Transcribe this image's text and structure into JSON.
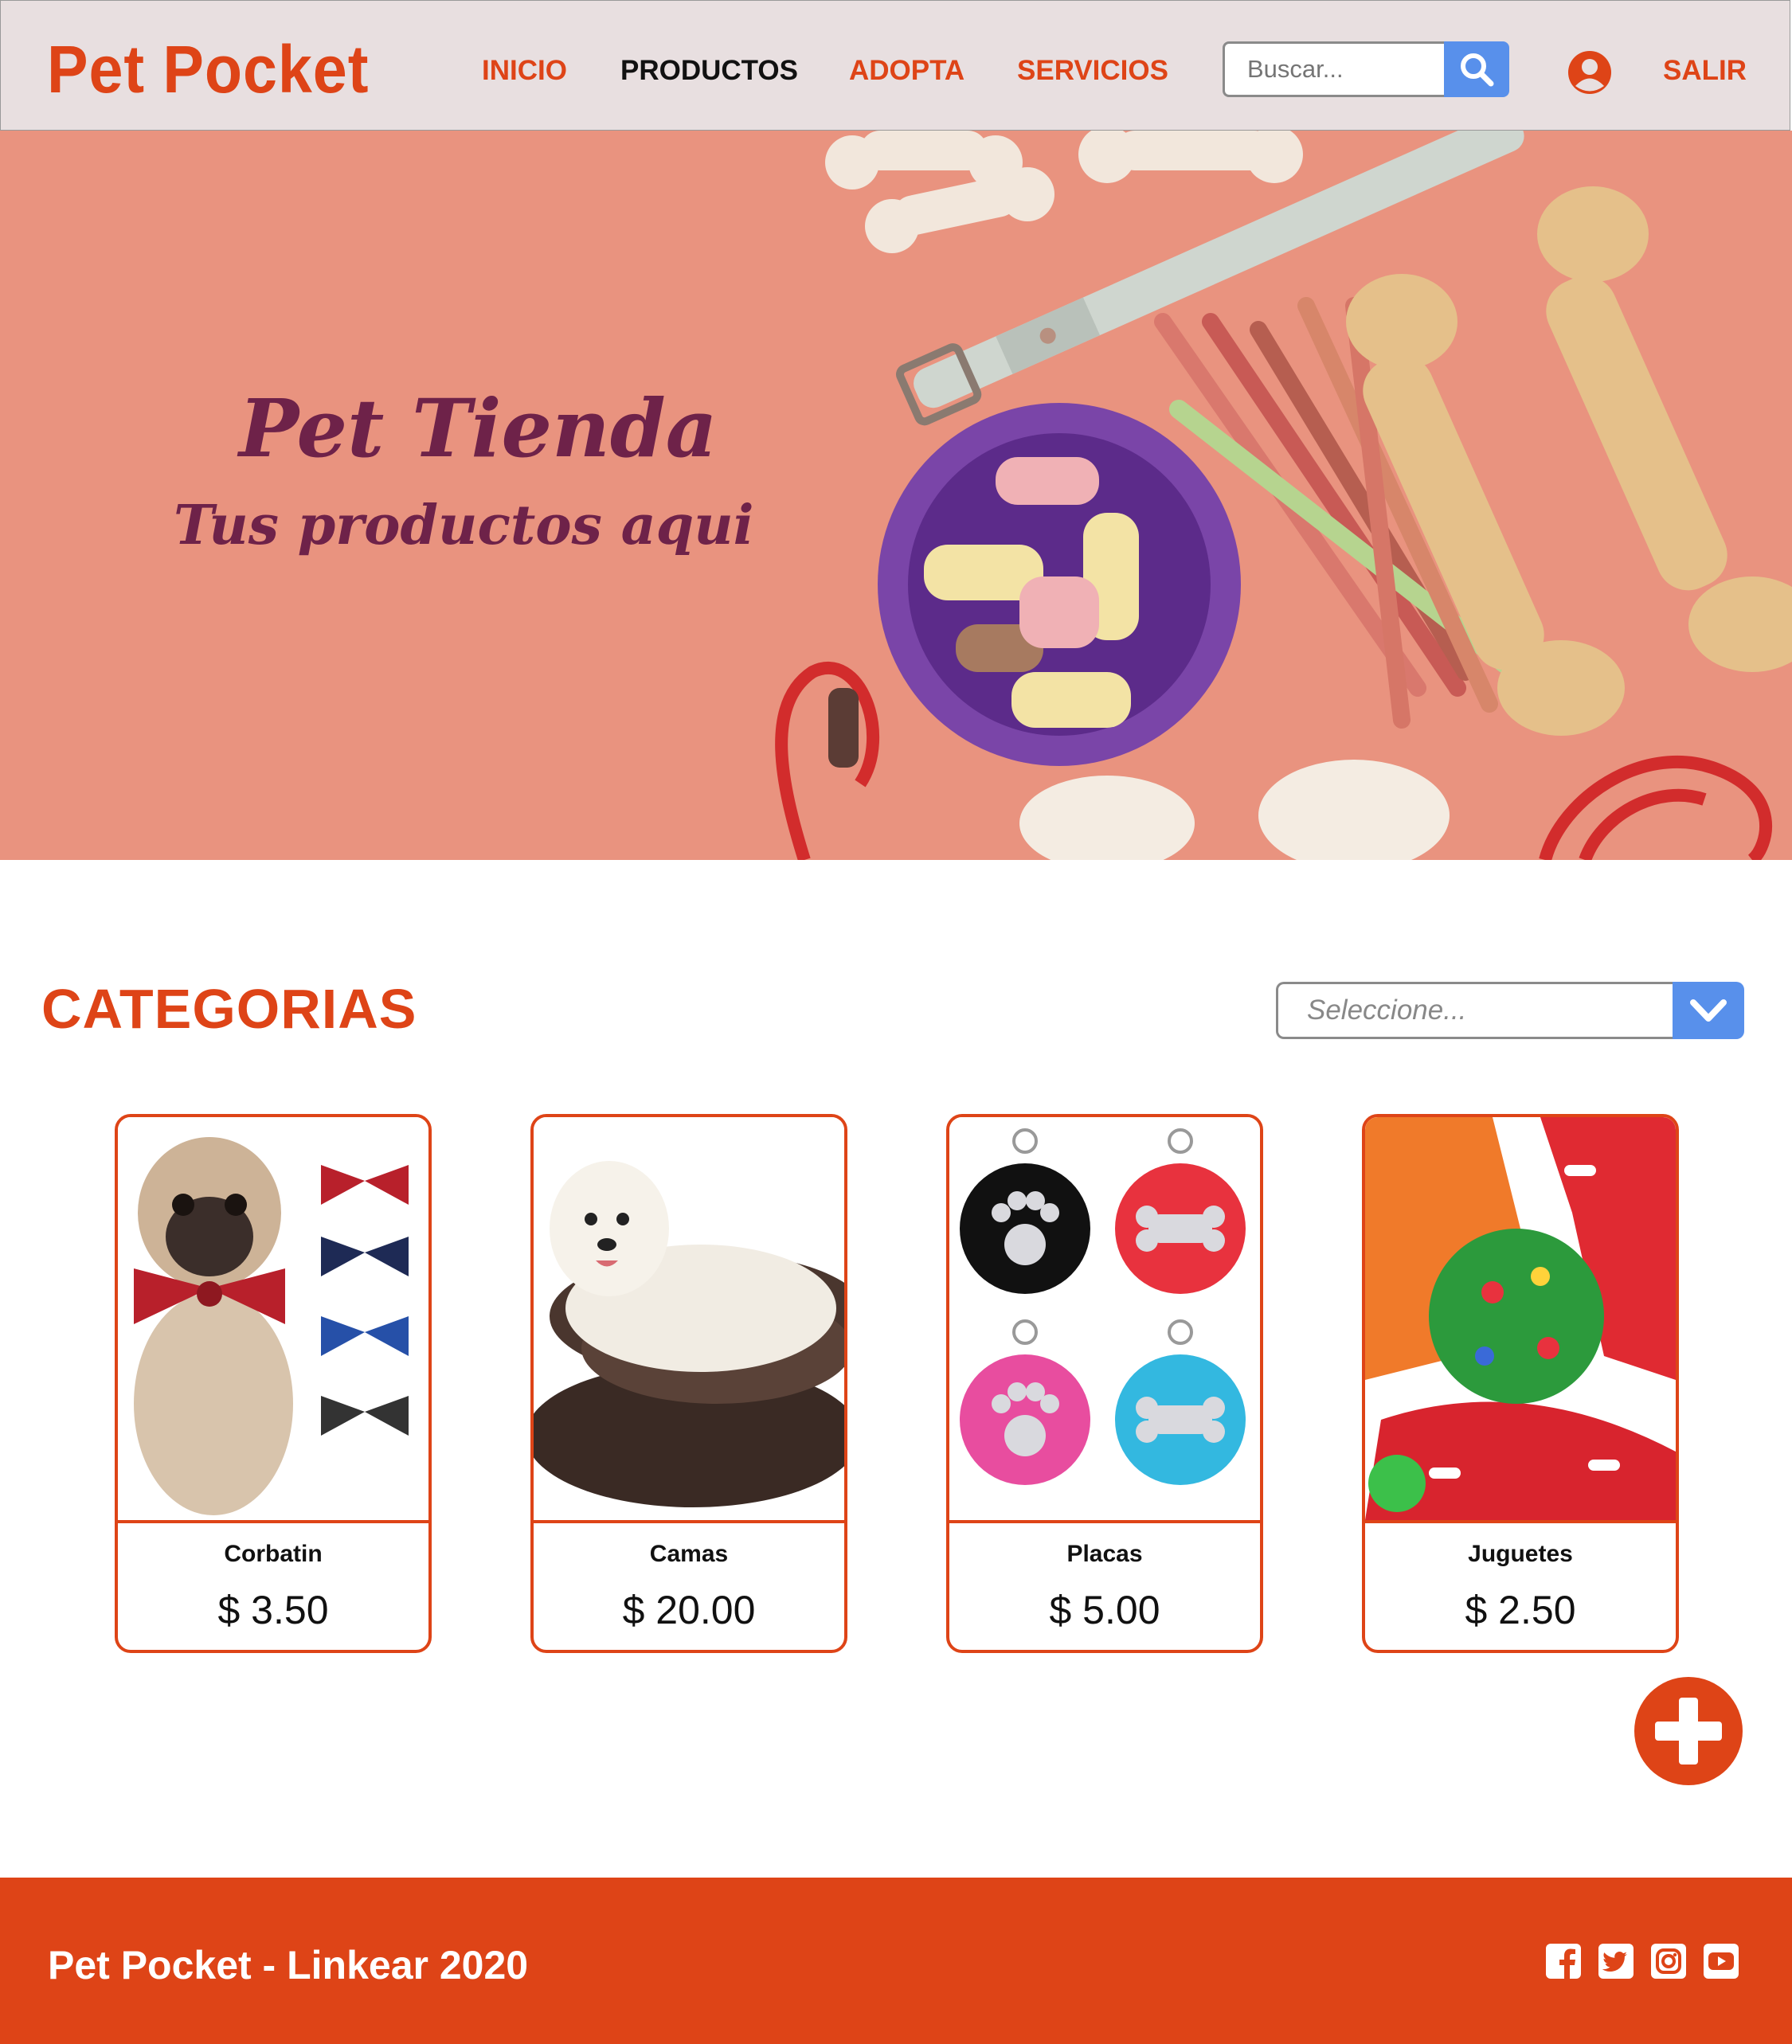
{
  "header": {
    "logo": "Pet Pocket",
    "nav": [
      "INICIO",
      "PRODUCTOS",
      "ADOPTA",
      "SERVICIOS"
    ],
    "active_nav": "PRODUCTOS",
    "search_placeholder": "Buscar...",
    "logout": "SALIR"
  },
  "hero": {
    "title": "Pet Tienda",
    "subtitle": "Tus productos aqui"
  },
  "categories": {
    "title": "CATEGORIAS",
    "select_placeholder": "Seleccione...",
    "items": [
      {
        "name": "Corbatin",
        "price": "$ 3.50"
      },
      {
        "name": "Camas",
        "price": "$ 20.00"
      },
      {
        "name": "Placas",
        "price": "$ 5.00"
      },
      {
        "name": "Juguetes",
        "price": "$ 2.50"
      }
    ]
  },
  "footer": {
    "text": "Pet Pocket - Linkear 2020",
    "social_icons": [
      "facebook-icon",
      "twitter-icon",
      "instagram-icon",
      "youtube-icon"
    ]
  },
  "colors": {
    "accent": "#de4417",
    "header_bg": "#e8dfe0",
    "hero_bg": "#e9937f",
    "hero_text": "#6e2249",
    "button_blue": "#5890eb"
  }
}
